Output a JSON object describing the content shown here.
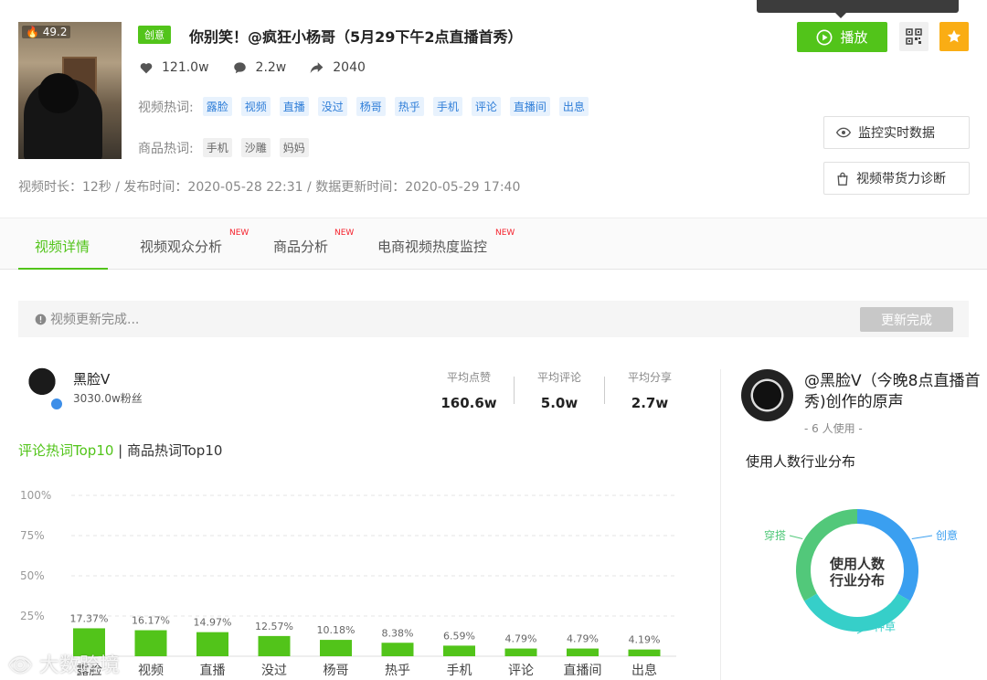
{
  "header": {
    "heat": "49.2",
    "category_tag": "创意",
    "title": "你别笑！@疯狂小杨哥（5月29下午2点直播首秀）",
    "likes": "121.0w",
    "comments": "2.2w",
    "shares": "2040",
    "video_keywords_label": "视频热词:",
    "video_keywords": [
      "露脸",
      "视频",
      "直播",
      "没过",
      "杨哥",
      "热乎",
      "手机",
      "评论",
      "直播间",
      "出息"
    ],
    "product_keywords_label": "商品热词:",
    "product_keywords": [
      "手机",
      "沙雕",
      "妈妈"
    ],
    "meta": "视频时长：12秒 / 发布时间：2020-05-28 22:31 / 数据更新时间：2020-05-29 17:40"
  },
  "actions": {
    "play_label": "播放",
    "monitor_label": "监控实时数据",
    "diagnose_label": "视频带货力诊断"
  },
  "tabs": [
    {
      "label": "视频详情",
      "new": ""
    },
    {
      "label": "视频观众分析",
      "new": "NEW"
    },
    {
      "label": "商品分析",
      "new": "NEW"
    },
    {
      "label": "电商视频热度监控",
      "new": "NEW"
    }
  ],
  "notice": {
    "text": "视频更新完成...",
    "button": "更新完成"
  },
  "author": {
    "name": "黑脸V",
    "fans": "3030.0w粉丝",
    "avg_likes_label": "平均点赞",
    "avg_likes": "160.6w",
    "avg_comments_label": "平均评论",
    "avg_comments": "5.0w",
    "avg_shares_label": "平均分享",
    "avg_shares": "2.7w"
  },
  "hot_tabs": {
    "comments": "评论热词Top10",
    "separator": " | ",
    "products": "商品热词Top10"
  },
  "chart_data": [
    {
      "type": "bar",
      "categories": [
        "露脸",
        "视频",
        "直播",
        "没过",
        "杨哥",
        "热乎",
        "手机",
        "评论",
        "直播间",
        "出息"
      ],
      "values": [
        17.37,
        16.17,
        14.97,
        12.57,
        10.18,
        8.38,
        6.59,
        4.79,
        4.79,
        4.19
      ],
      "value_labels": [
        "17.37%",
        "16.17%",
        "14.97%",
        "12.57%",
        "10.18%",
        "8.38%",
        "6.59%",
        "4.79%",
        "4.79%",
        "4.19%"
      ],
      "yticks": [
        "100%",
        "75%",
        "50%",
        "25%"
      ],
      "ylim": [
        0,
        100
      ],
      "grid": true,
      "color": "#52c41a"
    },
    {
      "type": "pie",
      "title": "使用人数行业分布",
      "center_label": [
        "使用人数",
        "行业分布"
      ],
      "categories": [
        "创意",
        "种草",
        "穿搭"
      ],
      "values": [
        1,
        1,
        1
      ],
      "colors": [
        "#3a9ff0",
        "#36cfc9",
        "#52c87a"
      ]
    }
  ],
  "music": {
    "title": "@黑脸V（今晚8点直播首秀)创作的原声",
    "users": "- 6 人使用 -"
  }
}
